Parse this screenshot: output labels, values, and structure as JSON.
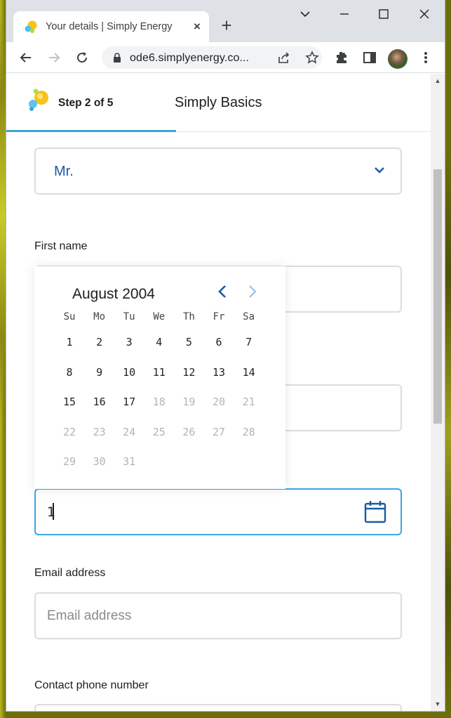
{
  "browser": {
    "tab_title": "Your details | Simply Energy",
    "url": "ode6.simplyenergy.co..."
  },
  "stepper": {
    "step_label": "Step 2 of 5",
    "plan_name": "Simply Basics"
  },
  "form": {
    "title_value": "Mr.",
    "first_name_label": "First name",
    "dob_value": "1",
    "email_label": "Email address",
    "email_placeholder": "Email address",
    "phone_label": "Contact phone number"
  },
  "datepicker": {
    "month_year": "August 2004",
    "weekdays": [
      "Su",
      "Mo",
      "Tu",
      "We",
      "Th",
      "Fr",
      "Sa"
    ],
    "weeks": [
      [
        {
          "d": "1",
          "on": true
        },
        {
          "d": "2",
          "on": true
        },
        {
          "d": "3",
          "on": true
        },
        {
          "d": "4",
          "on": true
        },
        {
          "d": "5",
          "on": true
        },
        {
          "d": "6",
          "on": true
        },
        {
          "d": "7",
          "on": true
        }
      ],
      [
        {
          "d": "8",
          "on": true
        },
        {
          "d": "9",
          "on": true
        },
        {
          "d": "10",
          "on": true
        },
        {
          "d": "11",
          "on": true
        },
        {
          "d": "12",
          "on": true
        },
        {
          "d": "13",
          "on": true
        },
        {
          "d": "14",
          "on": true
        }
      ],
      [
        {
          "d": "15",
          "on": true
        },
        {
          "d": "16",
          "on": true
        },
        {
          "d": "17",
          "on": true
        },
        {
          "d": "18",
          "on": false
        },
        {
          "d": "19",
          "on": false
        },
        {
          "d": "20",
          "on": false
        },
        {
          "d": "21",
          "on": false
        }
      ],
      [
        {
          "d": "22",
          "on": false
        },
        {
          "d": "23",
          "on": false
        },
        {
          "d": "24",
          "on": false
        },
        {
          "d": "25",
          "on": false
        },
        {
          "d": "26",
          "on": false
        },
        {
          "d": "27",
          "on": false
        },
        {
          "d": "28",
          "on": false
        }
      ],
      [
        {
          "d": "29",
          "on": false
        },
        {
          "d": "30",
          "on": false
        },
        {
          "d": "31",
          "on": false
        }
      ]
    ]
  },
  "colors": {
    "accent": "#3ba7db",
    "link_blue": "#1a5aa0",
    "disabled_day": "#b4b4b4"
  }
}
